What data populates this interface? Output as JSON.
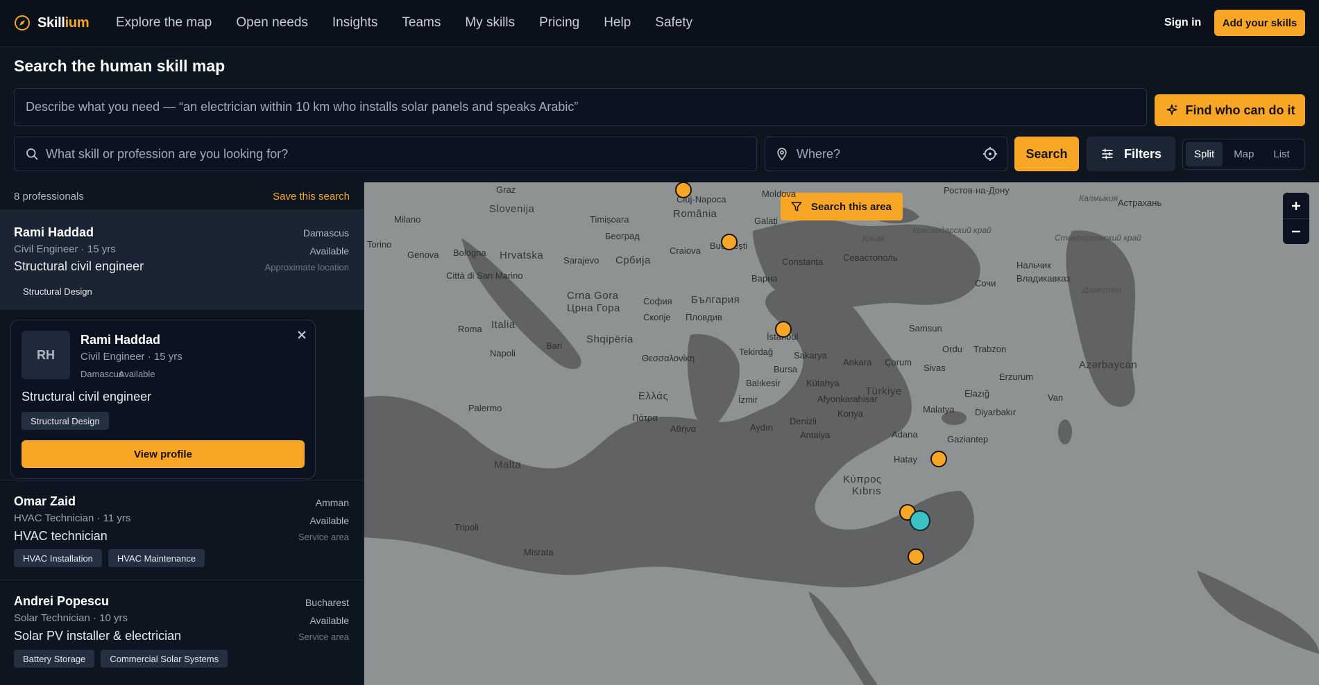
{
  "brand": {
    "name_prefix": "Skill",
    "name_suffix": "ium",
    "accent": "#f7a626"
  },
  "nav": {
    "links": [
      "Explore the map",
      "Open needs",
      "Insights",
      "Teams",
      "My skills",
      "Pricing",
      "Help",
      "Safety"
    ],
    "signin": "Sign in",
    "add_skills": "Add your skills"
  },
  "search": {
    "title": "Search the human skill map",
    "ai_placeholder": "Describe what you need — “an electrician within 10 km who installs solar panels and speaks Arabic”",
    "find_button": "Find who can do it",
    "skill_placeholder": "What skill or profession are you looking for?",
    "where_placeholder": "Where?",
    "search_button": "Search",
    "filters_button": "Filters",
    "views": [
      "Split",
      "Map",
      "List"
    ],
    "active_view": "Split"
  },
  "results": {
    "count": "8 professionals",
    "save": "Save this search",
    "items": [
      {
        "name": "Rami Haddad",
        "meta": "Civil Engineer · 15 yrs",
        "headline": "Structural civil engineer",
        "location": "Damascus",
        "status": "Available",
        "location_note": "Approximate location",
        "tags": [
          "Structural Design"
        ]
      },
      {
        "name": "Omar Zaid",
        "meta": "HVAC Technician · 11 yrs",
        "headline": "HVAC technician",
        "location": "Amman",
        "status": "Available",
        "location_note": "Service area",
        "tags": [
          "HVAC Installation",
          "HVAC Maintenance"
        ]
      },
      {
        "name": "Andrei Popescu",
        "meta": "Solar Technician · 10 yrs",
        "headline": "Solar PV installer & electrician",
        "location": "Bucharest",
        "status": "Available",
        "location_note": "Service area",
        "tags": [
          "Battery Storage",
          "Commercial Solar Systems"
        ]
      }
    ]
  },
  "preview": {
    "initials": "RH",
    "name": "Rami Haddad",
    "meta": "Civil Engineer · 15 yrs",
    "location": "Damascus",
    "status": "Available",
    "headline": "Structural civil engineer",
    "tag": "Structural Design",
    "button": "View profile"
  },
  "map": {
    "search_area": "Search this area",
    "labels": {
      "cluj": "Cluj-Napoca",
      "romania": "România",
      "bucuresti": "București",
      "constanta": "Constanța",
      "timisoara": "Timișoara",
      "beograd": "Београд",
      "srbija": "Србија",
      "craiova": "Craiova",
      "sarajevo": "Sarajevo",
      "hrvatska": "Hrvatska",
      "slovenija": "Slovenija",
      "graz": "Graz",
      "milano": "Milano",
      "torino": "Torino",
      "genova": "Genova",
      "bologna": "Bologna",
      "sanmarino": "Città di San Marino",
      "italia": "Italia",
      "roma": "Roma",
      "napoli": "Napoli",
      "bari": "Bari",
      "palermo": "Palermo",
      "malta": "Malta",
      "crnagora": "Crna Gora",
      "crnagora2": "Црна Гора",
      "sofia": "София",
      "bulgaria": "България",
      "skopje": "Скопје",
      "plovdiv": "Пловдив",
      "varna": "Варна",
      "shqiperia": "Shqipëria",
      "thessaloniki": "Θεσσαλονίκη",
      "ellas": "Ελλάς",
      "patra": "Πάτρα",
      "athina": "Αθήνα",
      "istanbul": "İstanbul",
      "tekirdag": "Tekirdağ",
      "bursa": "Bursa",
      "sakarya": "Sakarya",
      "ankara": "Ankara",
      "corum": "Çorum",
      "samsun": "Samsun",
      "ordu": "Ordu",
      "trabzon": "Trabzon",
      "sivas": "Sivas",
      "balikesir": "Balıkesir",
      "kutahya": "Kütahya",
      "afyon": "Afyonkarahisar",
      "izmir": "İzmir",
      "turkiye": "Türkiye",
      "konya": "Konya",
      "aydin": "Aydın",
      "denizli": "Denizli",
      "antalya": "Antalya",
      "adana": "Adana",
      "gaziantep": "Gaziantep",
      "hatay": "Hatay",
      "malatya": "Malatya",
      "elazig": "Elazığ",
      "diyarbakir": "Diyarbakır",
      "erzurum": "Erzurum",
      "van": "Van",
      "kibris": "Kıbrıs",
      "kypros": "Κύπρος",
      "tripoli": "Tripoli",
      "misrata": "Misrata",
      "sochi": "Сочи",
      "sevastopol": "Севастополь",
      "krym": "Крым",
      "rostov": "Ростов-на-Дону",
      "moldova": "Moldova",
      "galati": "Galați",
      "nalchik": "Нальчик",
      "vladikavkaz": "Владикавказ",
      "azarbaycan": "Azərbaycan",
      "kalmykia": "Калмыкия",
      "astrakhan": "Астрахань",
      "stavropol": "Ставропольский край",
      "krasnodar": "Краснодарский край",
      "dagestan": "Дагестан"
    }
  },
  "colors": {
    "accent": "#f7a626",
    "active_pin": "#3cc1c4",
    "background": "#0d1521"
  }
}
